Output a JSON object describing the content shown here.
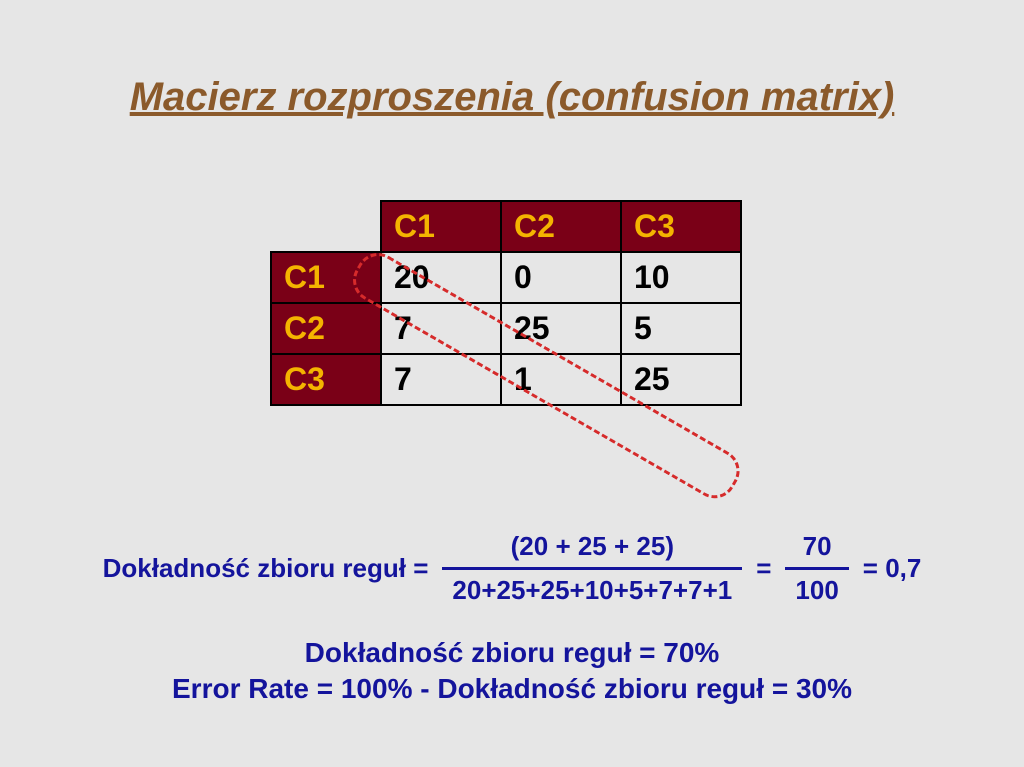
{
  "title": "Macierz rozproszenia (confusion matrix)",
  "matrix": {
    "col_headers": [
      "C1",
      "C2",
      "C3"
    ],
    "row_headers": [
      "C1",
      "C2",
      "C3"
    ],
    "rows": [
      [
        "20",
        "0",
        "10"
      ],
      [
        "7",
        "25",
        "5"
      ],
      [
        "7",
        "1",
        "25"
      ]
    ]
  },
  "formula": {
    "label": "Dokładność zbioru reguł =",
    "numerator1": "(20 + 25 + 25)",
    "denominator1": "20+25+25+10+5+7+7+1",
    "eq1": "=",
    "numerator2": "70",
    "denominator2": "100",
    "eq2": "= 0,7"
  },
  "conclusion": {
    "line1": "Dokładność zbioru reguł = 70%",
    "line2": "Error Rate = 100% - Dokładność zbioru reguł = 30%"
  },
  "chart_data": {
    "type": "table",
    "title": "Confusion matrix",
    "categories": [
      "C1",
      "C2",
      "C3"
    ],
    "rows": [
      {
        "label": "C1",
        "values": [
          20,
          0,
          10
        ]
      },
      {
        "label": "C2",
        "values": [
          7,
          25,
          5
        ]
      },
      {
        "label": "C3",
        "values": [
          7,
          1,
          25
        ]
      }
    ],
    "diagonal_sum": 70,
    "total_sum": 100,
    "accuracy": 0.7,
    "error_rate": 0.3
  }
}
